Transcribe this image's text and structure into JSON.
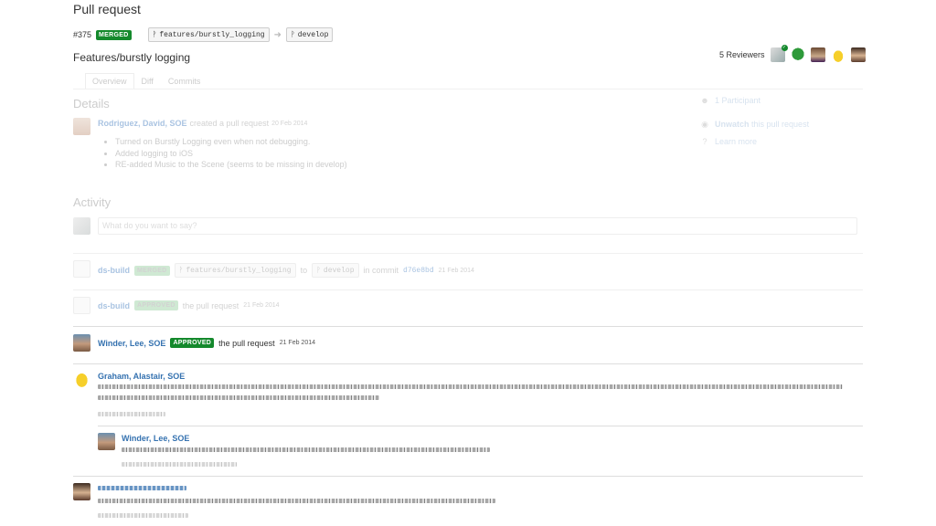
{
  "page_title": "Pull request",
  "pr": {
    "number": "#375",
    "status": "MERGED",
    "source_branch": "features/burstly_logging",
    "target_branch": "develop",
    "title": "Features/burstly logging"
  },
  "reviewers": {
    "label": "5 Reviewers",
    "count": "5"
  },
  "tabs": [
    "Overview",
    "Diff",
    "Commits"
  ],
  "details": {
    "heading": "Details",
    "author": "Rodriguez, David, SOE",
    "action": "created a pull request",
    "date": "20 Feb 2014",
    "items": [
      "Turned on Burstly Logging even when not debugging.",
      "Added logging to iOS",
      "RE-added Music to the Scene (seems to be missing in develop)"
    ]
  },
  "sidebar": {
    "participants": "1 Participant",
    "unwatch_bold": "Unwatch",
    "unwatch_rest": "this pull request",
    "learn_more": "Learn more"
  },
  "activity": {
    "heading": "Activity",
    "placeholder": "What do you want to say?",
    "merge_event": {
      "user": "ds-build",
      "badge": "MERGED",
      "source": "features/burstly_logging",
      "to": "to",
      "target": "develop",
      "in_commit": "in commit",
      "commit": "d76e8bd",
      "date": "21 Feb 2014"
    },
    "approve_event_1": {
      "user": "ds-build",
      "badge": "APPROVED",
      "text": "the pull request",
      "date": "21 Feb 2014"
    },
    "approve_event_2": {
      "user": "Winder, Lee, SOE",
      "badge": "APPROVED",
      "text": "the pull request",
      "date": "21 Feb 2014"
    },
    "comment_1": {
      "user": "Graham, Alastair, SOE"
    },
    "reply_1": {
      "user": "Winder, Lee, SOE"
    }
  },
  "colors": {
    "link": "#3572b0",
    "merged_badge": "#14892c"
  },
  "icons": [
    "branch-icon",
    "arrow-right-icon",
    "person-icon",
    "eye-icon",
    "help-circle-icon"
  ]
}
